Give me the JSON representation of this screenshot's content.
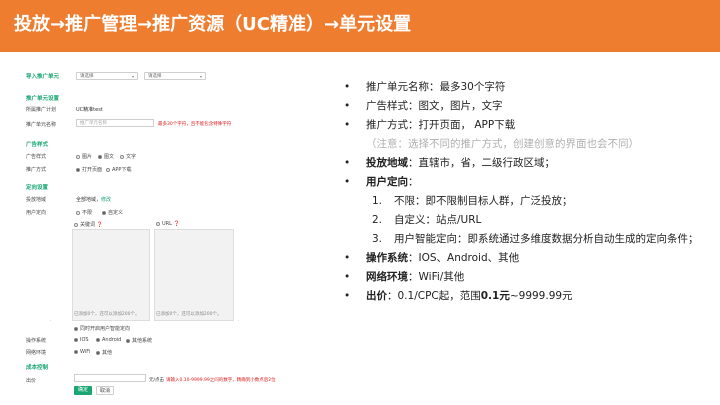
{
  "header": {
    "title": "投放→推广管理→推广资源（UC精准）→单元设置"
  },
  "form": {
    "import_label": "导入推广单元",
    "select1": "请选择",
    "select2": "请选择",
    "sec_unit": "推广单元设置",
    "plan_label": "所属推广计划",
    "plan_value": "UC精准test",
    "name_label": "推广单元名称",
    "name_placeholder": "推广单元名称",
    "name_hint": "最多30个字符，且不能包含特殊字符",
    "sec_style": "广告样式",
    "style_label": "广告样式",
    "style_opts": [
      "图片",
      "图文",
      "文字"
    ],
    "method_label": "推广方式",
    "method_opts": [
      "打开页面",
      "APP下载"
    ],
    "sec_target": "定向设置",
    "region_label": "投放地域",
    "region_value": "全部地域，",
    "region_link": "修改",
    "user_label": "用户定向",
    "user_opts": [
      "不限",
      "自定义"
    ],
    "kw_head": "关键词",
    "url_head": "URL",
    "kw_foot": "已添加0个，还可以添加200个。",
    "url_foot": "已添加0个，还可以添加200个。",
    "smart_label": "同时开启用户智能定向",
    "os_label": "操作系统",
    "os_opts": [
      "IOS",
      "Android",
      "其他系统"
    ],
    "net_label": "网络环境",
    "net_opts": [
      "WiFi",
      "其他"
    ],
    "sec_cost": "成本控制",
    "bid_label": "出价",
    "bid_unit": "元/点击",
    "bid_hint": "请输入0.10-9999.99之间的数字，精确到小数点后2位",
    "ok": "确定",
    "cancel": "取消"
  },
  "bullets": {
    "b1": "推广单元名称：最多30个字符",
    "b2": "广告样式：图文，图片，文字",
    "b3": "推广方式：打开页面， APP下载",
    "note": "（注意：选择不同的推广方式，创建创意的界面也会不同）",
    "b4_bold": "投放地域",
    "b4_rest": "：直辖市，省，二级行政区域；",
    "b5_bold": "用户定向",
    "b5_rest": "：",
    "s1_num": "1.",
    "s1": "不限：即不限制目标人群，广泛投放；",
    "s2_num": "2.",
    "s2": "自定义：站点/URL",
    "s3_num": "3.",
    "s3": "用户智能定向：即系统通过多维度数据分析自动生成的定向条件；",
    "b6_bold": "操作系统",
    "b6_rest": "：IOS、Android、其他",
    "b7_bold": "网络环境",
    "b7_rest": "：WiFi/其他",
    "b8_bold": "出价",
    "b8_mid": "：0.1/CPC起，范围",
    "b8_bold2": "0.1元",
    "b8_rest": "~9999.99元"
  }
}
